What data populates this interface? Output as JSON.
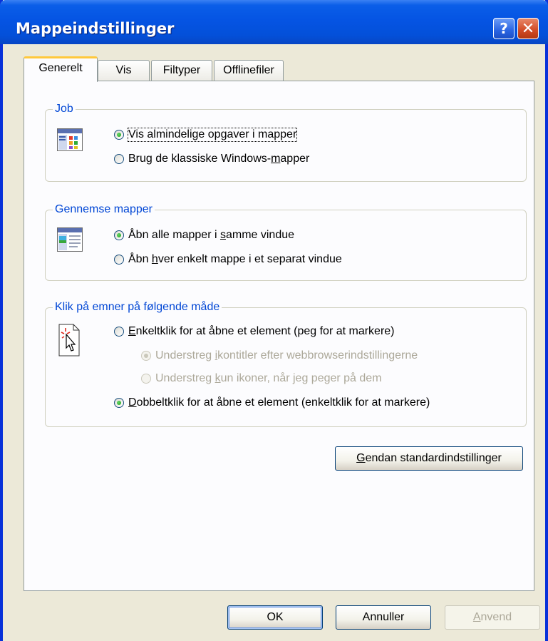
{
  "window": {
    "title": "Mappeindstillinger"
  },
  "titlebar": {
    "help_glyph": "?",
    "close_glyph": "✕"
  },
  "tabs": [
    {
      "label": "Generelt",
      "active": true
    },
    {
      "label": "Vis",
      "active": false
    },
    {
      "label": "Filtyper",
      "active": false
    },
    {
      "label": "Offlinefiler",
      "active": false
    }
  ],
  "job_group": {
    "title": "Job",
    "icon": "task-pane-folder-icon",
    "options": [
      {
        "label": "Vis almindelige opgaver i mapper",
        "checked": true
      },
      {
        "pre": "Brug de klassiske Windows-",
        "ul": "m",
        "post": "apper",
        "checked": false
      }
    ]
  },
  "browse_group": {
    "title": "Gennemse mapper",
    "icon": "browse-window-icon",
    "options": [
      {
        "pre": "Åbn alle mapper i ",
        "ul": "s",
        "post": "amme vindue",
        "checked": true
      },
      {
        "pre": "Åbn ",
        "ul": "h",
        "post": "ver enkelt mappe i et separat vindue",
        "checked": false
      }
    ]
  },
  "click_group": {
    "title": "Klik på emner på følgende måde",
    "icon": "click-pointer-icon",
    "options": [
      {
        "pre": "",
        "ul": "E",
        "post": "nkeltklik for at åbne et element (peg for at markere)",
        "checked": false
      },
      {
        "pre": "Understreg ",
        "ul": "i",
        "post": "kontitler efter webbrowserindstillingerne",
        "checked": true,
        "disabled": true
      },
      {
        "pre": "Understreg ",
        "ul": "k",
        "post": "un ikoner, når jeg peger på dem",
        "checked": false,
        "disabled": true
      },
      {
        "pre": "",
        "ul": "D",
        "post": "obbeltklik for at åbne et element (enkeltklik for at markere)",
        "checked": true
      }
    ]
  },
  "restore_button": {
    "pre": "",
    "ul": "G",
    "post": "endan standardindstillinger"
  },
  "footer": {
    "ok_label": "OK",
    "cancel_label": "Annuller",
    "apply": {
      "pre": "",
      "ul": "A",
      "post": "nvend",
      "disabled": true
    }
  },
  "colors": {
    "titlebar": "#0554e3",
    "group_title": "#0046d5",
    "dialog_bg": "#ece9d8",
    "radio_dot": "#21a121"
  }
}
